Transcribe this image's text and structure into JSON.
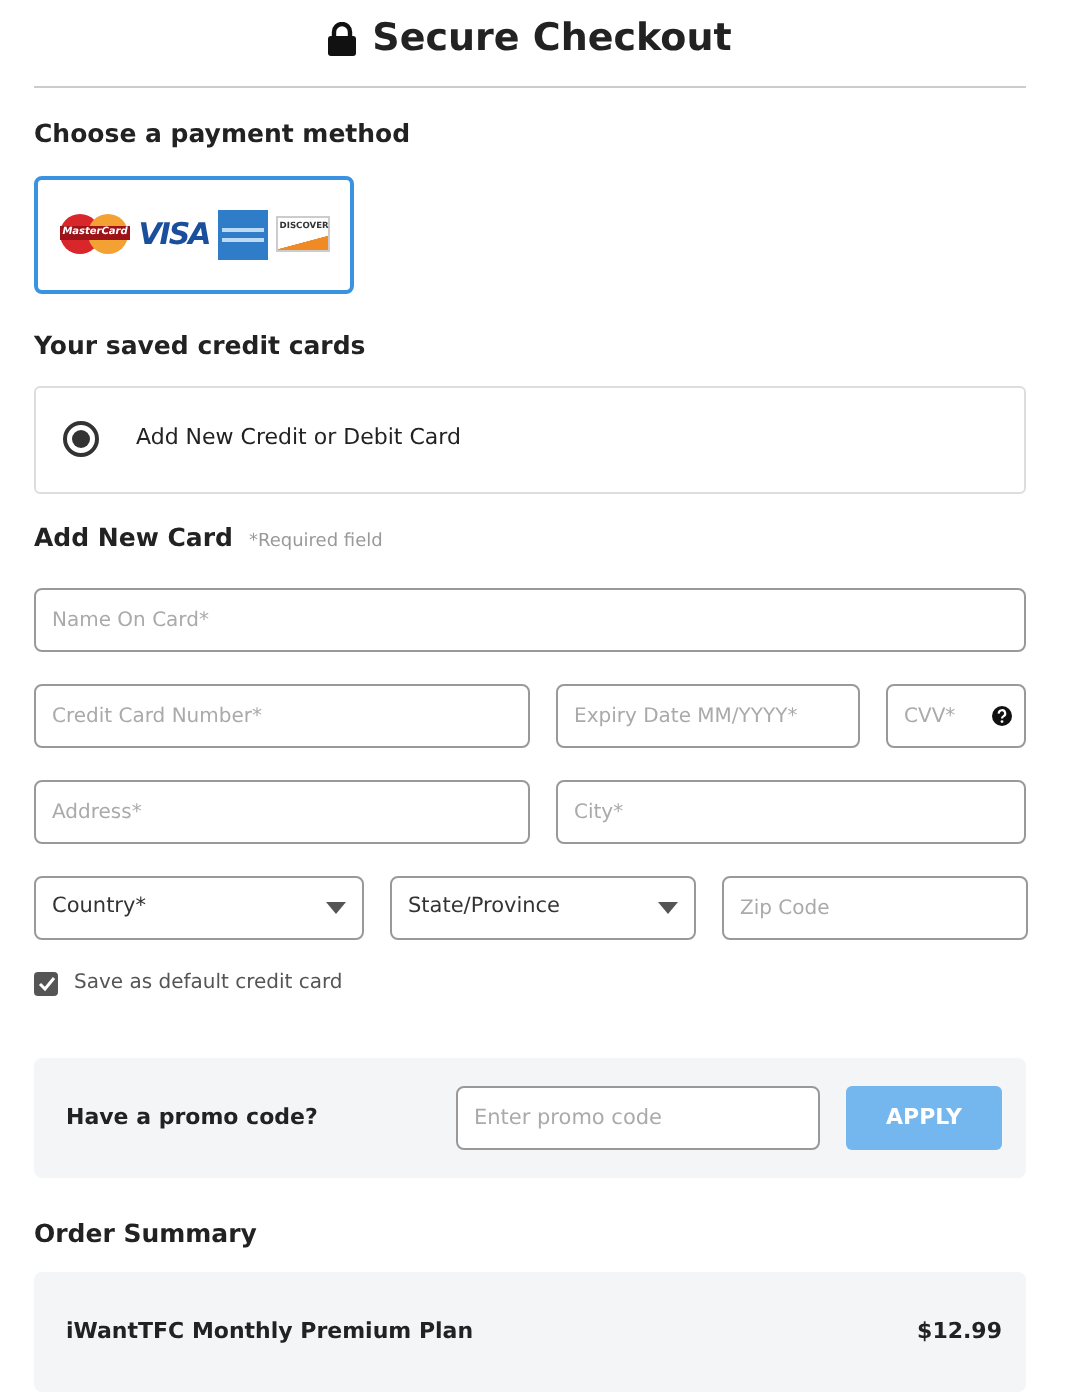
{
  "header": {
    "title": "Secure Checkout"
  },
  "payment_method": {
    "heading": "Choose a payment method",
    "selected": true,
    "logos": [
      {
        "kind": "mastercard",
        "label": "MasterCard"
      },
      {
        "kind": "visa",
        "label": "VISA"
      },
      {
        "kind": "amex"
      },
      {
        "kind": "discover",
        "label": "DISCOVER"
      }
    ]
  },
  "saved_cards": {
    "heading": "Your saved credit cards",
    "options": [
      {
        "label": "Add New Credit or Debit Card",
        "selected": true
      }
    ]
  },
  "new_card": {
    "heading": "Add New Card",
    "note": "*Required field",
    "rows": [
      [
        {
          "kind": "input",
          "placeholder": "Name On Card*"
        }
      ],
      [
        {
          "kind": "input",
          "placeholder": "Credit Card Number*"
        },
        {
          "kind": "input",
          "placeholder": "Expiry Date MM/YYYY*"
        },
        {
          "kind": "help",
          "placeholder": "CVV*"
        }
      ],
      [
        {
          "kind": "input",
          "placeholder": "Address*"
        },
        {
          "kind": "input",
          "placeholder": "City*"
        }
      ],
      [
        {
          "kind": "select",
          "value": "Country*"
        },
        {
          "kind": "select",
          "value": "State/Province"
        },
        {
          "kind": "input",
          "placeholder": "Zip Code"
        }
      ]
    ],
    "save_default": {
      "label": "Save as default credit card",
      "checked": true
    }
  },
  "promo": {
    "label": "Have a promo code?",
    "placeholder": "Enter promo code",
    "button": "APPLY",
    "disabled": true
  },
  "order_summary": {
    "heading": "Order Summary",
    "items": [
      {
        "name": "iWantTFC Monthly Premium Plan",
        "price": "$12.99"
      }
    ]
  }
}
